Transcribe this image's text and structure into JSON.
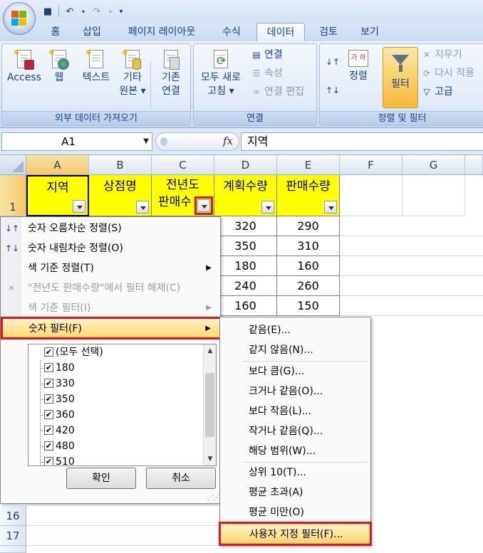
{
  "ribbon_tabs": [
    "홈",
    "삽입",
    "페이지 레이아웃",
    "수식",
    "데이터",
    "검토",
    "보기"
  ],
  "active_tab": "데이터",
  "groups": {
    "external": {
      "label": "외부 데이터 가져오기",
      "buttons": [
        "Access",
        "웹",
        "텍스트",
        "기타",
        "원본 ▾",
        "기존",
        "연결"
      ]
    },
    "connections": {
      "label": "연결",
      "refresh": [
        "모두 새로",
        "고침 ▾"
      ],
      "items": [
        "연결",
        "속성",
        "연결 편집"
      ]
    },
    "sortfilter": {
      "label": "정렬 및 필터",
      "sort_label": "정렬",
      "sort_icon_text": "가 하",
      "filter_label": "필터",
      "items": [
        "지우기",
        "다시 적용",
        "고급"
      ]
    }
  },
  "formula_bar": {
    "name_box": "A1",
    "fx": "fx",
    "value": "지역"
  },
  "columns": [
    "A",
    "B",
    "C",
    "D",
    "E",
    "F",
    "G"
  ],
  "rows": [
    "1",
    "16",
    "17"
  ],
  "header_cells": {
    "a": "지역",
    "b": "상점명",
    "c1": "전년도",
    "c2": "판매수",
    "d": "계획수량",
    "e": "판매수량"
  },
  "data_d": [
    "320",
    "350",
    "180",
    "240",
    "160"
  ],
  "data_e": [
    "290",
    "310",
    "160",
    "260",
    "150"
  ],
  "filter_menu": {
    "sort_asc": "숫자 오름차순 정렬(S)",
    "sort_desc": "숫자 내림차순 정렬(O)",
    "sort_color": "색 기준 정렬(T)",
    "clear_filter": "\"전년도 판매수량\"에서 필터 해제(C)",
    "color_filter": "색 기준 필터(I)",
    "number_filter": "숫자 필터(F)",
    "list": [
      "(모두 선택)",
      "180",
      "330",
      "350",
      "360",
      "420",
      "480",
      "510"
    ],
    "ok": "확인",
    "cancel": "취소"
  },
  "submenu": [
    "같음(E)...",
    "같지 않음(N)...",
    "보다 큼(G)...",
    "크거나 같음(O)...",
    "보다 작음(L)...",
    "작거나 같음(Q)...",
    "해당 범위(W)...",
    "상위 10(T)...",
    "평균 초과(A)",
    "평균 미만(O)",
    "사용자 지정 필터(F)..."
  ],
  "colors": {
    "header_fill": "#ffff00",
    "highlight_box": "#e0161e",
    "ribbon_text": "#15428b"
  }
}
